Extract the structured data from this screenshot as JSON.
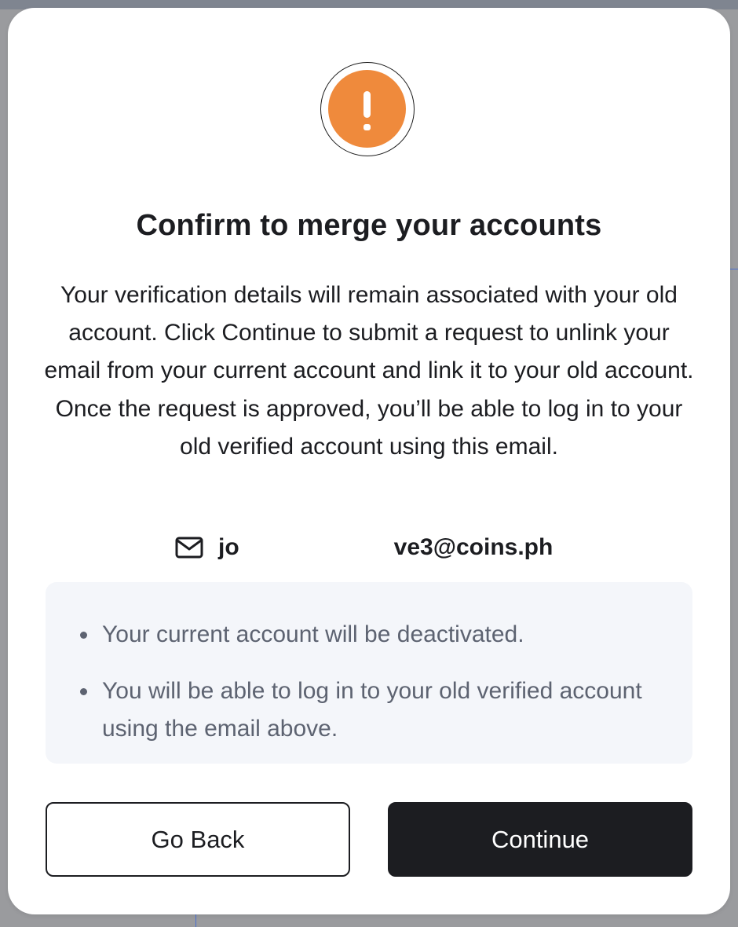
{
  "dialog": {
    "title": "Confirm to merge your accounts",
    "description": "Your verification details will remain associated with your old account. Click Continue to submit a request to unlink your email from your current account and link it to your old account. Once the request is approved, you’ll be able to log in to your old verified account using this email.",
    "email": {
      "icon": "mail-icon",
      "visible_start": "jo",
      "visible_end": "ve3@coins.ph"
    },
    "notes": [
      "Your current account will be deactivated.",
      "You will be able to log in to your old verified account using the email above."
    ],
    "buttons": {
      "back_label": "Go Back",
      "continue_label": "Continue"
    },
    "alert_icon": "exclamation-icon",
    "colors": {
      "alert": "#ef8a3c",
      "primary": "#1c1d21",
      "info_bg": "#f4f6fa",
      "muted_text": "#5d6371"
    }
  }
}
